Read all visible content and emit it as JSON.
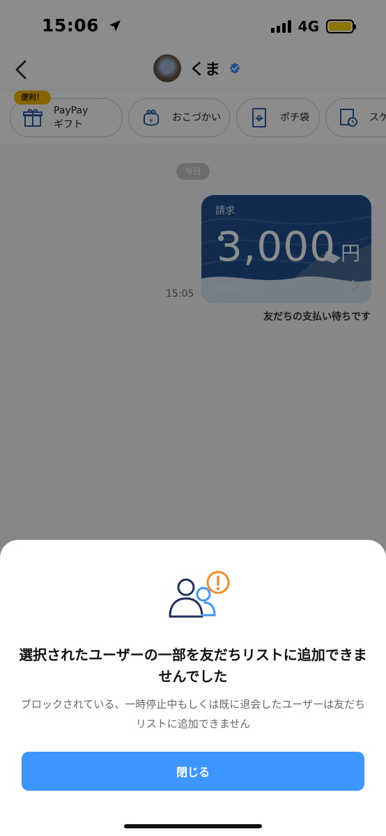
{
  "status_bar": {
    "time": "15:06",
    "network": "4G"
  },
  "header": {
    "user_name": "くま"
  },
  "quick_actions": {
    "badge": "便利！",
    "items": [
      {
        "label": "PayPay\nギフト"
      },
      {
        "label": "おこづかい"
      },
      {
        "label": "ポチ袋"
      },
      {
        "label": "スケ"
      }
    ]
  },
  "chat": {
    "date_label": "今日",
    "invoice": {
      "label": "請求",
      "amount": "3,000",
      "currency": "円",
      "detail_link": "詳細を見る"
    },
    "message_time": "15:05",
    "message_status": "友だちの支払い待ちです"
  },
  "sheet": {
    "title": "選択されたユーザーの一部を友だちリストに追加できませんでした",
    "description": "ブロックされている、一時停止中もしくは既に退会したユーザーは友だちリストに追加できません",
    "close_label": "閉じる"
  },
  "colors": {
    "accent": "#3d96ff",
    "card": "#1f4f8f",
    "warning": "#f28c28",
    "badge": "#f5b700"
  }
}
